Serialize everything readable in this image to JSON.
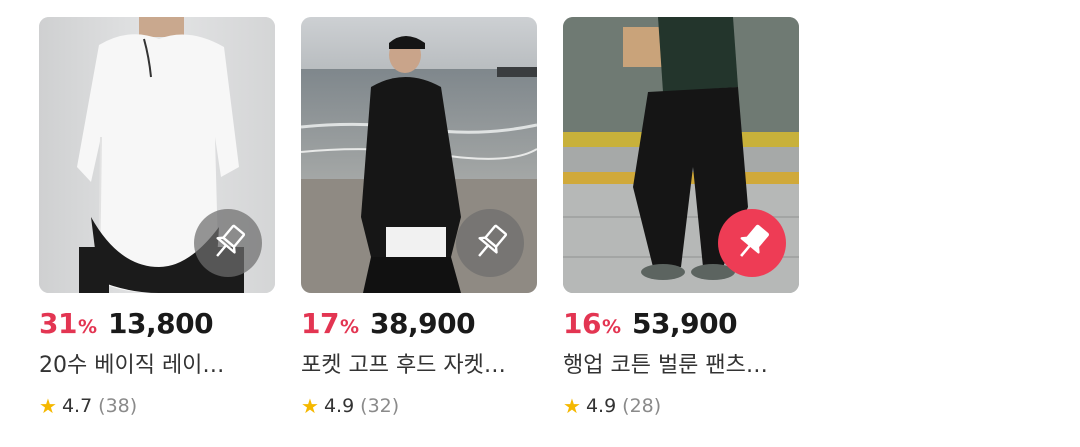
{
  "products": [
    {
      "discount": "31",
      "percent_sign": "%",
      "price": "13,800",
      "name": "20수 베이직 레이…",
      "rating": "4.7",
      "reviews": "(38)",
      "pinned": false
    },
    {
      "discount": "17",
      "percent_sign": "%",
      "price": "38,900",
      "name": "포켓 고프 후드 자켓…",
      "rating": "4.9",
      "reviews": "(32)",
      "pinned": false
    },
    {
      "discount": "16",
      "percent_sign": "%",
      "price": "53,900",
      "name": "행업 코튼 벌룬 팬츠…",
      "rating": "4.9",
      "reviews": "(28)",
      "pinned": true
    }
  ],
  "icons": {
    "pin": "pushpin-icon",
    "star": "star-icon"
  },
  "colors": {
    "discount": "#e33552",
    "pin_active": "#ee3c55",
    "star": "#f5b800"
  }
}
